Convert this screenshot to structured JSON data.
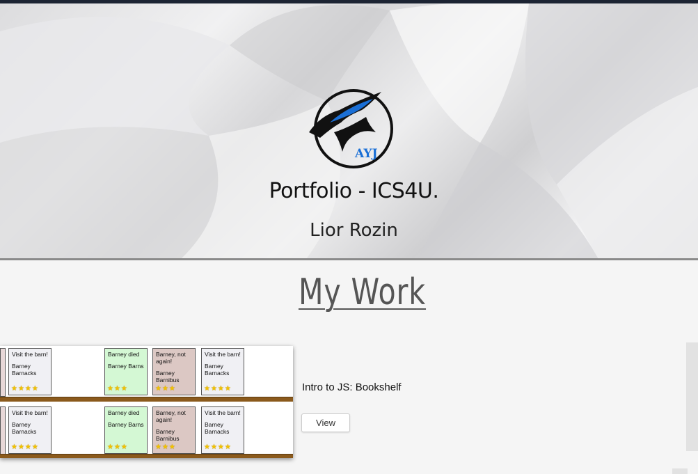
{
  "hero": {
    "logo_text": "AYJ",
    "title": "Portfolio - ICS4U.",
    "name": "Lior Rozin"
  },
  "section": {
    "title": "My Work"
  },
  "projects": [
    {
      "title": "Intro to JS: Bookshelf",
      "view_label": "View",
      "thumbnail": {
        "rows": [
          {
            "books": [
              {
                "title": "Visit the barn!",
                "author": "Barney Barnacks",
                "stars": "★★★★",
                "color": "#f0f0f4"
              },
              {
                "title": "Barney died",
                "author": "Barney Barns",
                "stars": "★★★",
                "color": "#d4f8d4"
              },
              {
                "title": "Barney, not again!",
                "author": "Barney Barnibus",
                "stars": "★★★",
                "color": "#dcc8c4"
              },
              {
                "title": "Visit the barn!",
                "author": "Barney Barnacks",
                "stars": "★★★★",
                "color": "#f0f0f4"
              }
            ]
          },
          {
            "books": [
              {
                "title": "Visit the barn!",
                "author": "Barney Barnacks",
                "stars": "★★★★",
                "color": "#f0f0f4"
              },
              {
                "title": "Barney died",
                "author": "Barney Barns",
                "stars": "★★★",
                "color": "#d4f8d4"
              },
              {
                "title": "Barney, not again!",
                "author": "Barney Barnibus",
                "stars": "★★★",
                "color": "#dcc8c4"
              },
              {
                "title": "Visit the barn!",
                "author": "Barney Barnacks",
                "stars": "★★★★",
                "color": "#f0f0f4"
              }
            ]
          }
        ]
      }
    }
  ],
  "colors": {
    "top_bar": "#1c2433",
    "shelf_wood": "#8b5a1c",
    "logo_blue": "#1a6fd6"
  }
}
